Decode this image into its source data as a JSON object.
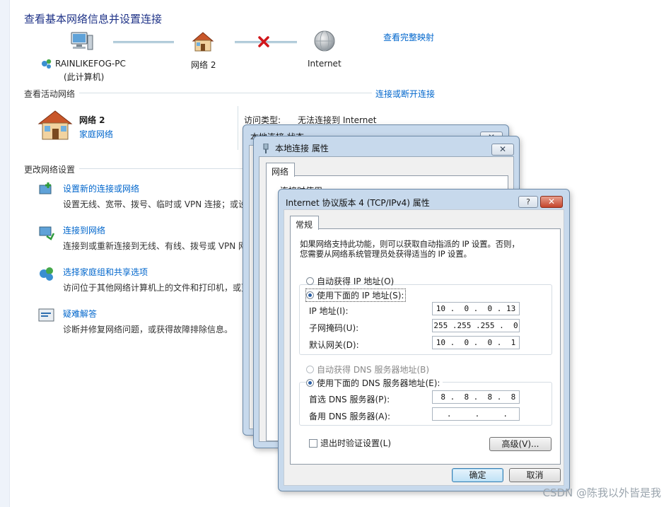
{
  "header": {
    "title": "查看基本网络信息并设置连接",
    "full_map_link": "查看完整映射"
  },
  "network_map": {
    "computer_name": "RAINLIKEFOG-PC",
    "computer_sub": "(此计算机)",
    "network_name": "网络  2",
    "internet": "Internet"
  },
  "active": {
    "section_label": "查看活动网络",
    "connect_link": "连接或断开连接",
    "network_name": "网络  2",
    "network_type": "家庭网络",
    "access_type_label": "访问类型:",
    "access_type_value": "无法连接到 Internet"
  },
  "change": {
    "section_label": "更改网络设置",
    "tasks": [
      {
        "title": "设置新的连接或网络",
        "desc": "设置无线、宽带、拨号、临时或 VPN 连接；或设"
      },
      {
        "title": "连接到网络",
        "desc": "连接到或重新连接到无线、有线、拨号或 VPN 网"
      },
      {
        "title": "选择家庭组和共享选项",
        "desc": "访问位于其他网络计算机上的文件和打印机，或更"
      },
      {
        "title": "疑难解答",
        "desc": "诊断并修复网络问题，或获得故障排除信息。"
      }
    ]
  },
  "status_dialog": {
    "title": "本地连接 状态",
    "close": "✕"
  },
  "props_dialog": {
    "title": "本地连接 属性",
    "tab": "网络",
    "connect_using": "连接时使用:",
    "close": "✕"
  },
  "ipv4_dialog": {
    "title": "Internet 协议版本 4 (TCP/IPv4) 属性",
    "help": "?",
    "close": "✕",
    "tab": "常规",
    "intro_line1": "如果网络支持此功能，则可以获取自动指派的 IP 设置。否则，",
    "intro_line2": "您需要从网络系统管理员处获得适当的 IP 设置。",
    "auto_ip": "自动获得 IP 地址(O)",
    "manual_ip": "使用下面的 IP 地址(S):",
    "ip_label": "IP 地址(I):",
    "ip_value": "10 .  0 .  0 . 13",
    "mask_label": "子网掩码(U):",
    "mask_value": "255 .255 .255 .  0",
    "gateway_label": "默认网关(D):",
    "gateway_value": "10 .  0 .  0 .  1",
    "auto_dns": "自动获得 DNS 服务器地址(B)",
    "manual_dns": "使用下面的 DNS 服务器地址(E):",
    "dns1_label": "首选 DNS 服务器(P):",
    "dns1_value": " 8 .  8 .  8 .  8",
    "dns2_label": "备用 DNS 服务器(A):",
    "dns2_value": "   .     .     .   ",
    "validate": "退出时验证设置(L)",
    "advanced": "高级(V)...",
    "ok": "确定",
    "cancel": "取消"
  },
  "watermark": "CSDN @陈我以外皆是我"
}
